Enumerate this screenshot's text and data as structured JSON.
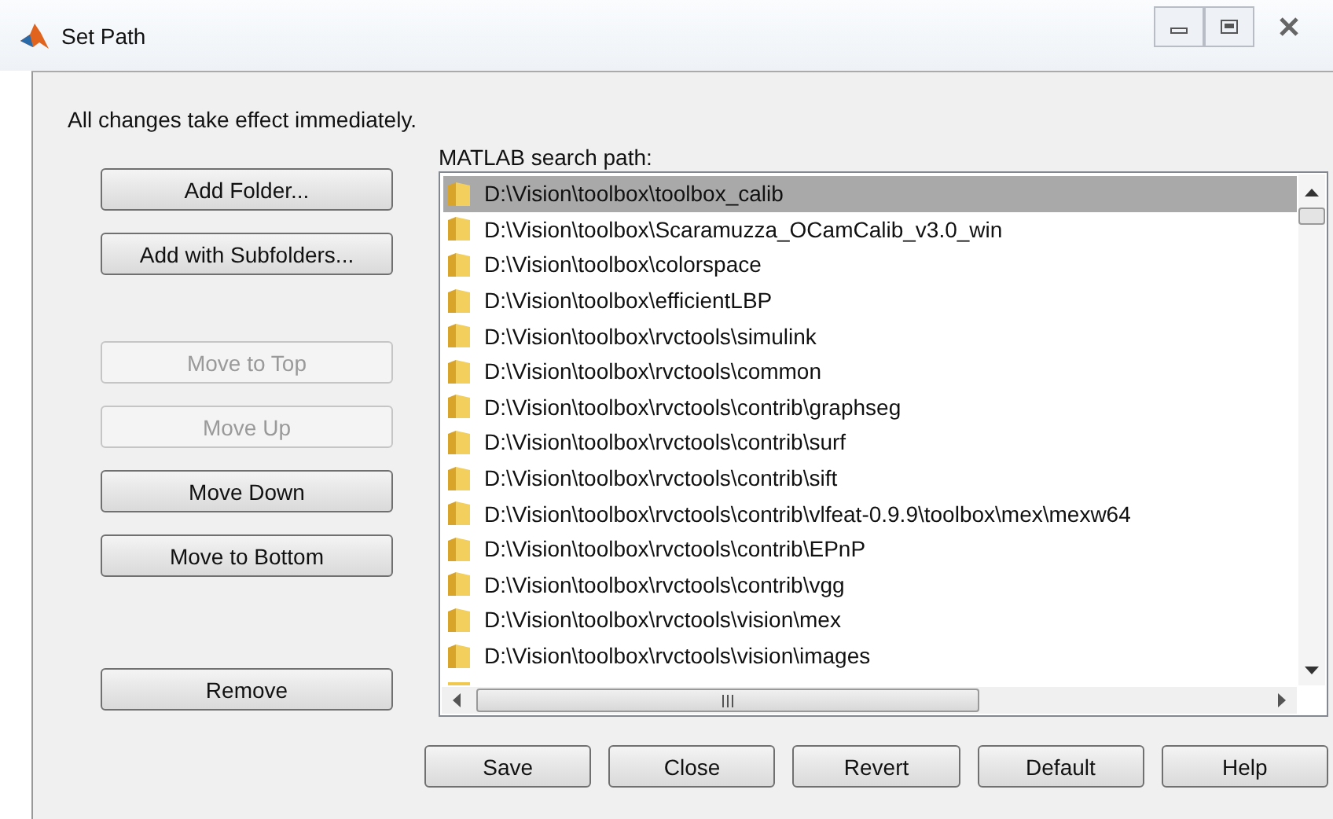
{
  "window": {
    "title": "Set Path"
  },
  "notice": "All changes take effect immediately.",
  "left_button_groups": [
    [
      {
        "label": "Add Folder...",
        "disabled": false
      },
      {
        "label": "Add with Subfolders...",
        "disabled": false
      }
    ],
    [
      {
        "label": "Move to Top",
        "disabled": true
      },
      {
        "label": "Move Up",
        "disabled": true
      },
      {
        "label": "Move Down",
        "disabled": false
      },
      {
        "label": "Move to Bottom",
        "disabled": false
      }
    ],
    [
      {
        "label": "Remove",
        "disabled": false
      }
    ]
  ],
  "path_list": {
    "label": "MATLAB search path:",
    "items": [
      {
        "path": "D:\\Vision\\toolbox\\toolbox_calib",
        "selected": true
      },
      {
        "path": "D:\\Vision\\toolbox\\Scaramuzza_OCamCalib_v3.0_win",
        "selected": false
      },
      {
        "path": "D:\\Vision\\toolbox\\colorspace",
        "selected": false
      },
      {
        "path": "D:\\Vision\\toolbox\\efficientLBP",
        "selected": false
      },
      {
        "path": "D:\\Vision\\toolbox\\rvctools\\simulink",
        "selected": false
      },
      {
        "path": "D:\\Vision\\toolbox\\rvctools\\common",
        "selected": false
      },
      {
        "path": "D:\\Vision\\toolbox\\rvctools\\contrib\\graphseg",
        "selected": false
      },
      {
        "path": "D:\\Vision\\toolbox\\rvctools\\contrib\\surf",
        "selected": false
      },
      {
        "path": "D:\\Vision\\toolbox\\rvctools\\contrib\\sift",
        "selected": false
      },
      {
        "path": "D:\\Vision\\toolbox\\rvctools\\contrib\\vlfeat-0.9.9\\toolbox\\mex\\mexw64",
        "selected": false
      },
      {
        "path": "D:\\Vision\\toolbox\\rvctools\\contrib\\EPnP",
        "selected": false
      },
      {
        "path": "D:\\Vision\\toolbox\\rvctools\\contrib\\vgg",
        "selected": false
      },
      {
        "path": "D:\\Vision\\toolbox\\rvctools\\vision\\mex",
        "selected": false
      },
      {
        "path": "D:\\Vision\\toolbox\\rvctools\\vision\\images",
        "selected": false
      }
    ]
  },
  "bottom_buttons": [
    "Save",
    "Close",
    "Revert",
    "Default",
    "Help"
  ]
}
